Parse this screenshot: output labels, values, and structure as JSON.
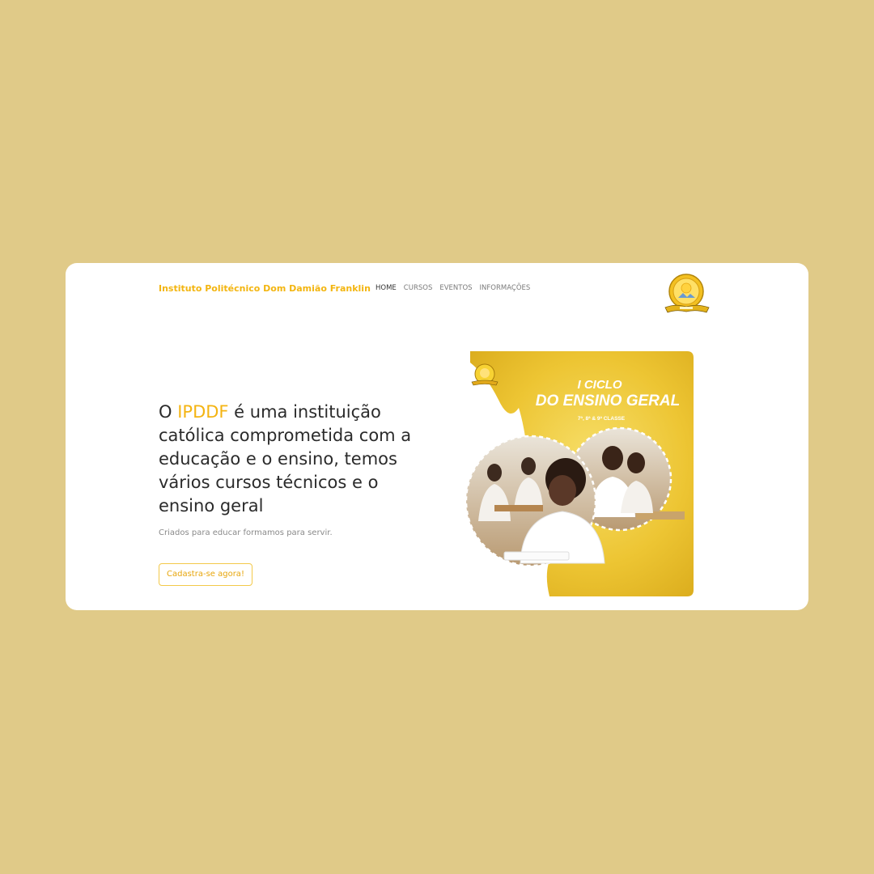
{
  "header": {
    "brand": "Instituto Politécnico Dom Damião Franklin",
    "nav": [
      {
        "label": "HOME",
        "active": true
      },
      {
        "label": "CURSOS",
        "active": false
      },
      {
        "label": "EVENTOS",
        "active": false
      },
      {
        "label": "INFORMAÇÕES",
        "active": false
      }
    ],
    "logo_icon": "school-crest-icon"
  },
  "hero": {
    "headline_prefix": "O ",
    "headline_accent": "IPDDF",
    "headline_rest": " é uma instituição católica comprometida com a educação e o ensino, temos vários cursos técnicos e o ensino geral",
    "subtitle": "Criados para educar formamos para servir.",
    "cta_label": "Cadastra-se agora!"
  },
  "banner": {
    "line1": "I CICLO",
    "line2": "DO ENSINO GERAL",
    "line3": "7ª, 8ª & 9ª CLASSE"
  },
  "colors": {
    "page_background": "#e0ca88",
    "accent": "#f4b412",
    "banner_gold": "#f0cf3e"
  }
}
